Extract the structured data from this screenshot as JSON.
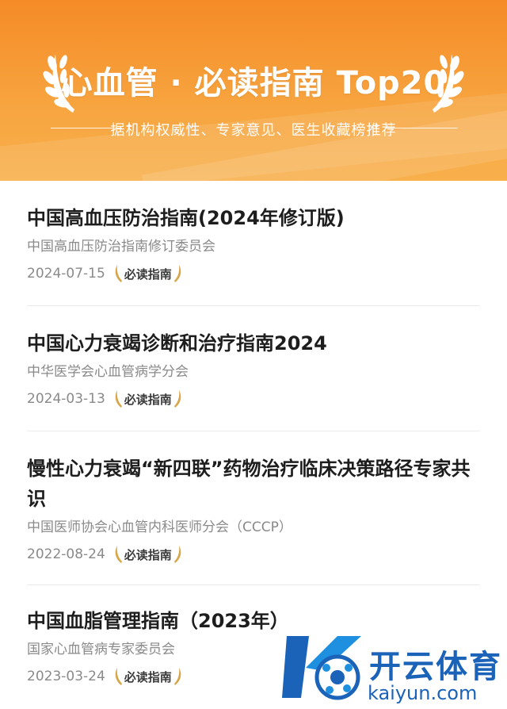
{
  "banner": {
    "title": "心血管 · 必读指南 Top20",
    "subtitle": "据机构权威性、专家意见、医生收藏榜推荐",
    "bg_color": "#f6a13b"
  },
  "items": [
    {
      "title": "中国高血压防治指南(2024年修订版)",
      "org": "中国高血压防治指南修订委员会",
      "date": "2024-07-15",
      "badge": "必读指南"
    },
    {
      "title": "中国心力衰竭诊断和治疗指南2024",
      "org": "中华医学会心血管病学分会",
      "date": "2024-03-13",
      "badge": "必读指南"
    },
    {
      "title": "慢性心力衰竭“新四联”药物治疗临床决策路径专家共识",
      "org": "中国医师协会心血管内科医师分会（CCCP）",
      "date": "2022-08-24",
      "badge": "必读指南"
    },
    {
      "title": "中国血脂管理指南（2023年）",
      "org": "国家心血管病专家委员会",
      "date": "2023-03-24",
      "badge": "必读指南"
    }
  ],
  "watermark": {
    "brand": "开云体育",
    "url": "kaiyun.com"
  }
}
